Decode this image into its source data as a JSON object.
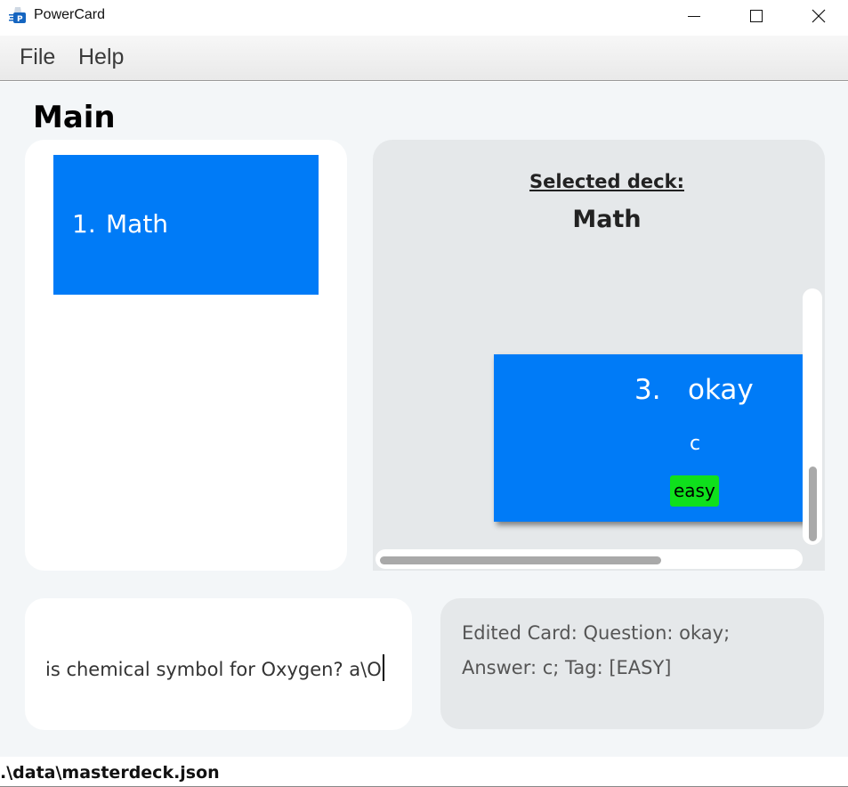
{
  "window": {
    "title": "PowerCard",
    "icon": "powercard-app-icon"
  },
  "menu": {
    "items": [
      {
        "label": "File"
      },
      {
        "label": "Help"
      }
    ]
  },
  "main": {
    "title": "Main",
    "deck_list": [
      {
        "index": "1.",
        "name": "Math"
      }
    ],
    "selected_deck": {
      "label": "Selected deck:",
      "name": "Math"
    },
    "cards": [
      {
        "index": "3.",
        "question": "okay",
        "answer": "c",
        "tag": "easy"
      }
    ],
    "colors": {
      "accent": "#007bf7",
      "tag_easy": "#0fe01c",
      "panel_light": "#ffffff",
      "panel_grey": "#e5e8ea",
      "background": "#f3f6f8"
    }
  },
  "command": {
    "value": "is chemical symbol for Oxygen? a\\O"
  },
  "result": {
    "text": "Edited Card: Question: okay; Answer: c; Tag: [EASY]"
  },
  "status": {
    "path": ".\\data\\masterdeck.json"
  }
}
